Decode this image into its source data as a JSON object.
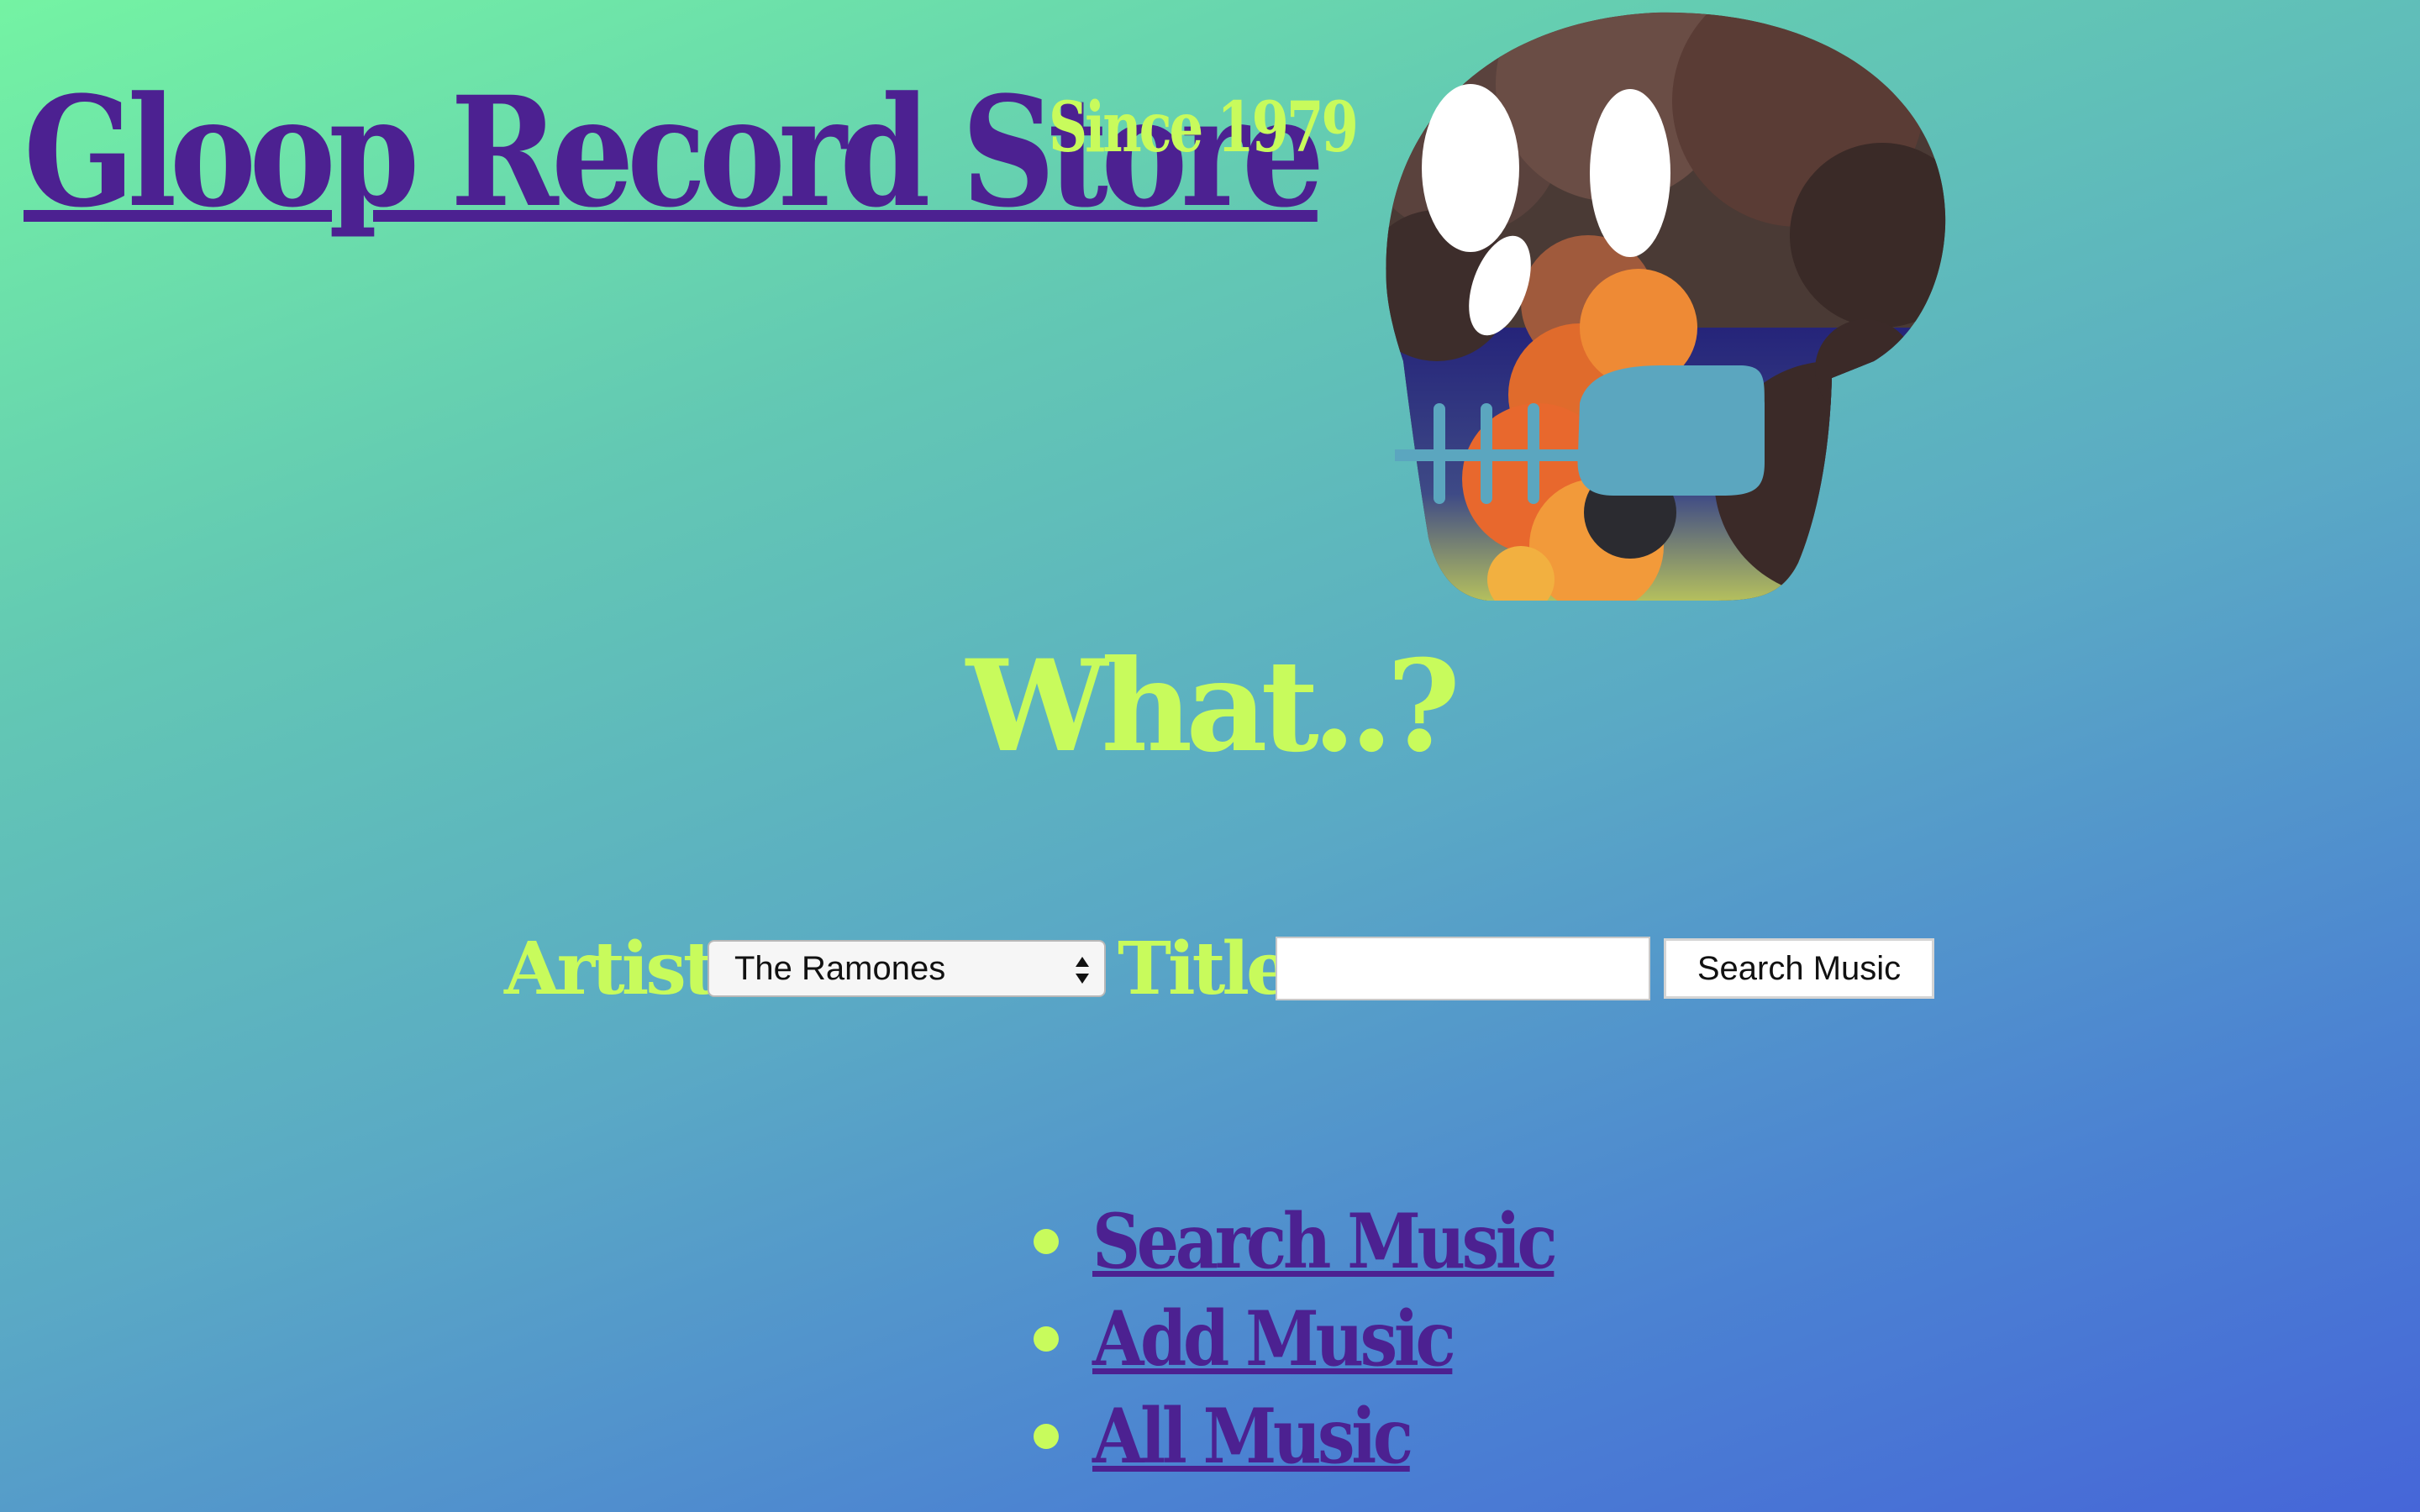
{
  "header": {
    "site_title": "Gloop Record Store",
    "since": "Since 1979"
  },
  "main": {
    "heading": "What..?"
  },
  "search_form": {
    "artist_label": "Artist:",
    "artist_selected": "The Ramones",
    "title_label": "Title:",
    "title_value": "",
    "title_placeholder": "",
    "submit_label": "Search Music"
  },
  "nav": {
    "items": [
      {
        "label": "Search Music"
      },
      {
        "label": "Add Music"
      },
      {
        "label": "All Music"
      }
    ]
  },
  "colors": {
    "title_purple": "#4c2191",
    "accent_lime": "#c8fb5c",
    "gradient_start": "#74f3a3",
    "gradient_end": "#4666d8"
  },
  "icons": {
    "hero_art": "skull-icon",
    "select_arrows": "updown-arrows-icon"
  }
}
